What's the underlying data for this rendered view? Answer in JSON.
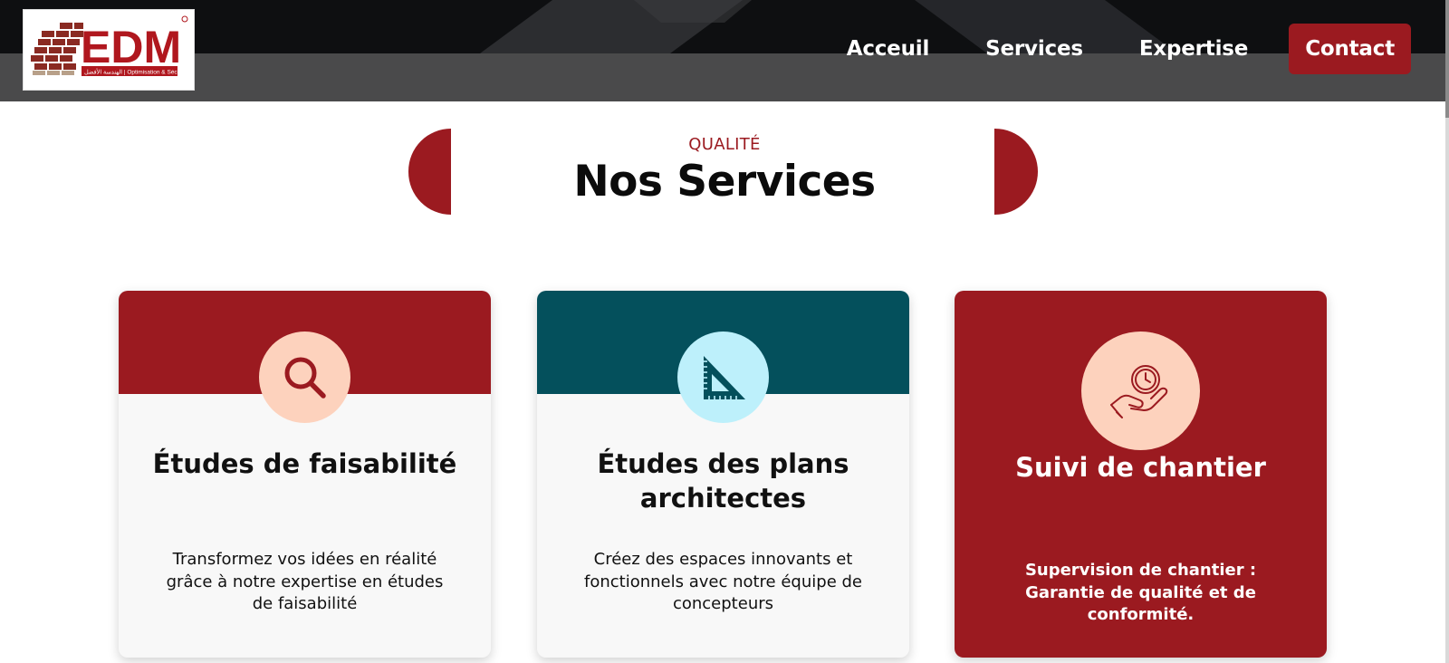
{
  "header": {
    "logo": {
      "brand": "EDM",
      "tagline": "الهندسة الأفضل | Optimisation & Sécurité"
    },
    "nav": [
      {
        "label": "Acceuil"
      },
      {
        "label": "Services"
      },
      {
        "label": "Expertise"
      },
      {
        "label": "Contact"
      }
    ]
  },
  "section": {
    "eyebrow": "QUALITÉ",
    "title": "Nos Services"
  },
  "cards": [
    {
      "icon": "search-icon",
      "title": "Études de faisabilité",
      "description": "Transformez vos idées en réalité grâce à notre expertise en études de faisabilité"
    },
    {
      "icon": "set-square-icon",
      "title": "Études des plans architectes",
      "description": "Créez des espaces innovants et fonctionnels avec notre équipe de concepteurs"
    },
    {
      "icon": "hand-clock-icon",
      "title": "Suivi de chantier",
      "description": "Supervision de chantier : Garantie de qualité et de conformité."
    }
  ],
  "colors": {
    "brand_red": "#9b1a20",
    "teal": "#04505c",
    "peach": "#fdd2bd",
    "light_cyan": "#bdf0fb",
    "header_dark": "#0e0f11",
    "header_grey": "#4a4a4b"
  }
}
